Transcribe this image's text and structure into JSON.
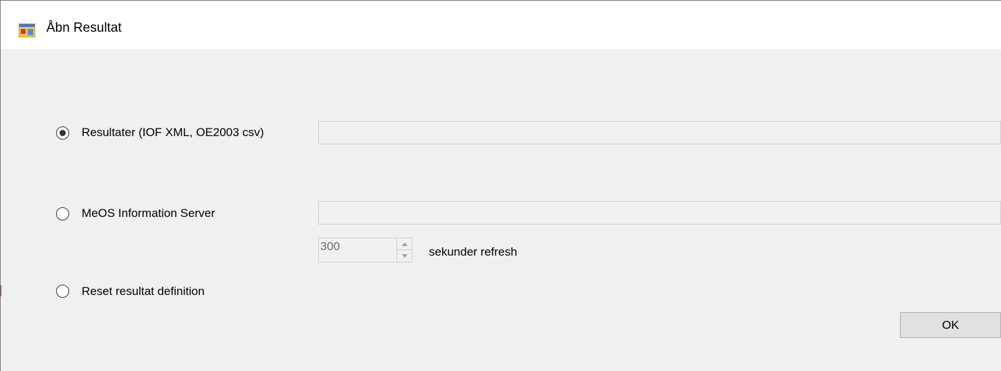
{
  "window": {
    "title": "Åbn Resultat",
    "icon": "windows-form-app-icon"
  },
  "options": [
    {
      "label": "Resultater (IOF XML, OE2003 csv)",
      "selected": true,
      "field_value": ""
    },
    {
      "label": "MeOS Information Server",
      "selected": false,
      "field_value": ""
    },
    {
      "label": "Reset resultat definition",
      "selected": false
    }
  ],
  "refresh": {
    "value": "300",
    "label": "sekunder refresh"
  },
  "buttons": {
    "ok_label": "OK"
  }
}
